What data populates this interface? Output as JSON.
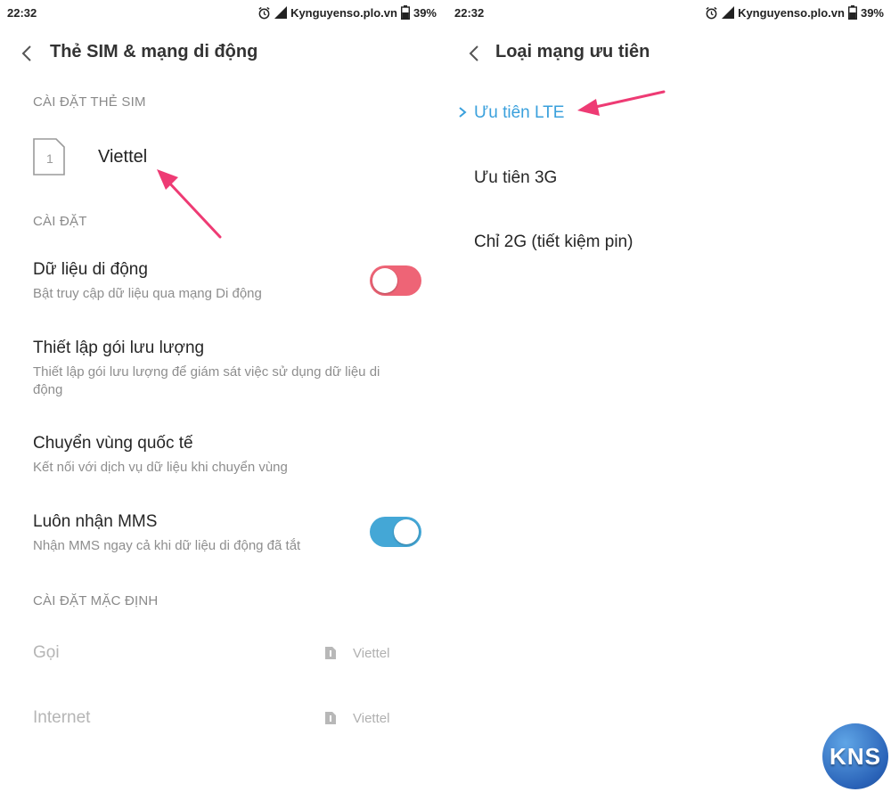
{
  "status_bar": {
    "time": "22:32",
    "carrier": "Kynguyenso.plo.vn",
    "battery": "39%"
  },
  "left_screen": {
    "title": "Thẻ SIM & mạng di động",
    "sim_section": "CÀI ĐẶT THẺ SIM",
    "sim_icon_number": "1",
    "sim_name": "Viettel",
    "settings_section": "CÀI ĐẶT",
    "items": [
      {
        "title": "Dữ liệu di động",
        "subtitle": "Bật truy cập dữ liệu qua mạng Di động",
        "toggle": "off"
      },
      {
        "title": "Thiết lập gói lưu lượng",
        "subtitle": "Thiết lập gói lưu lượng để giám sát việc sử dụng dữ liệu di động"
      },
      {
        "title": "Chuyển vùng quốc tế",
        "subtitle": "Kết nối với dịch vụ dữ liệu khi chuyển vùng"
      },
      {
        "title": "Luôn nhận MMS",
        "subtitle": "Nhận MMS ngay cả khi dữ liệu di động đã tắt",
        "toggle": "on"
      }
    ],
    "default_section": "CÀI ĐẶT MẶC ĐỊNH",
    "defaults": [
      {
        "label": "Gọi",
        "value": "Viettel"
      },
      {
        "label": "Internet",
        "value": "Viettel"
      }
    ]
  },
  "right_screen": {
    "title": "Loại mạng ưu tiên",
    "options": [
      {
        "label": "Ưu tiên LTE",
        "selected": true
      },
      {
        "label": "Ưu tiên 3G",
        "selected": false
      },
      {
        "label": "Chỉ 2G (tiết kiệm pin)",
        "selected": false
      }
    ]
  },
  "watermark": "KNS",
  "colors": {
    "accent_blue": "#44a7d6",
    "toggle_off": "#ee6476",
    "arrow": "#ee3b74",
    "selected_text": "#3aa0dc"
  }
}
